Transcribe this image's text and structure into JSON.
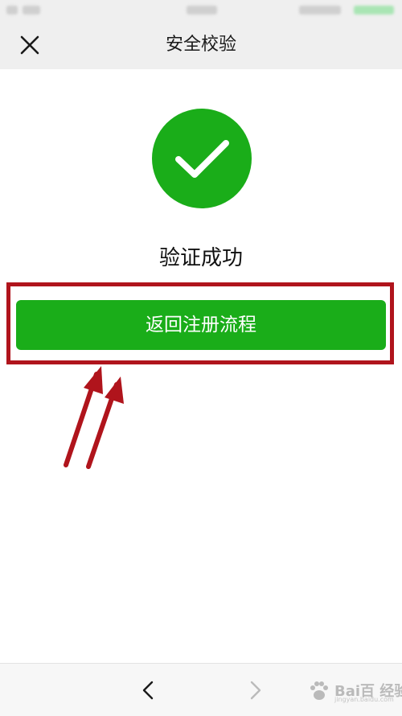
{
  "header": {
    "title": "安全校验",
    "close_icon": "close-icon"
  },
  "result": {
    "icon": "checkmark-circle-icon",
    "message": "验证成功"
  },
  "primary_action": {
    "label": "返回注册流程"
  },
  "bottom_bar": {
    "back_icon": "chevron-left-icon",
    "forward_icon": "chevron-right-icon"
  },
  "watermark": {
    "text": "Bai百 经验",
    "sub": "jingyan.baidu.com"
  },
  "colors": {
    "success_green": "#1aad19",
    "highlight_red": "#b0141c",
    "header_bg": "#efefef"
  }
}
